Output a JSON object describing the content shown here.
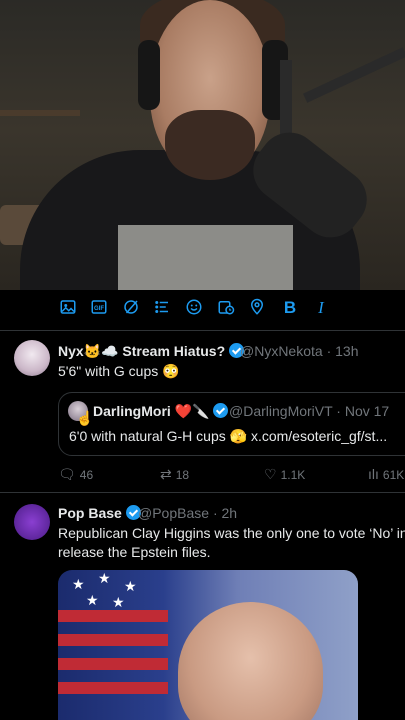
{
  "toolbar": {
    "icons": [
      "image-icon",
      "gif-icon",
      "grok-icon",
      "poll-icon",
      "emoji-icon",
      "schedule-icon",
      "location-icon",
      "bold-icon",
      "italic-icon"
    ],
    "bold_label": "B",
    "italic_label": "I",
    "accent": "#1d9bf0"
  },
  "tweet1": {
    "display_name": "Nyx🐱☁️ Stream Hiatus?",
    "handle": "@NyxNekota",
    "time": "· 13h",
    "text": "5'6\" with G cups 😳",
    "quote": {
      "display_name": "DarlingMori ❤️🔪",
      "handle": "@DarlingMoriVT · Nov 17",
      "text": "6'0 with natural G-H cups 🫣 x.com/esoteric_gf/st..."
    },
    "replies": "46",
    "retweets": "18",
    "likes": "1.1K",
    "views": "61K"
  },
  "tweet2": {
    "display_name": "Pop Base",
    "handle": "@PopBase",
    "time": "· 2h",
    "text_line1": "Republican Clay Higgins was the only one to vote ‘No’ in th",
    "text_line2": "release the Epstein files."
  }
}
